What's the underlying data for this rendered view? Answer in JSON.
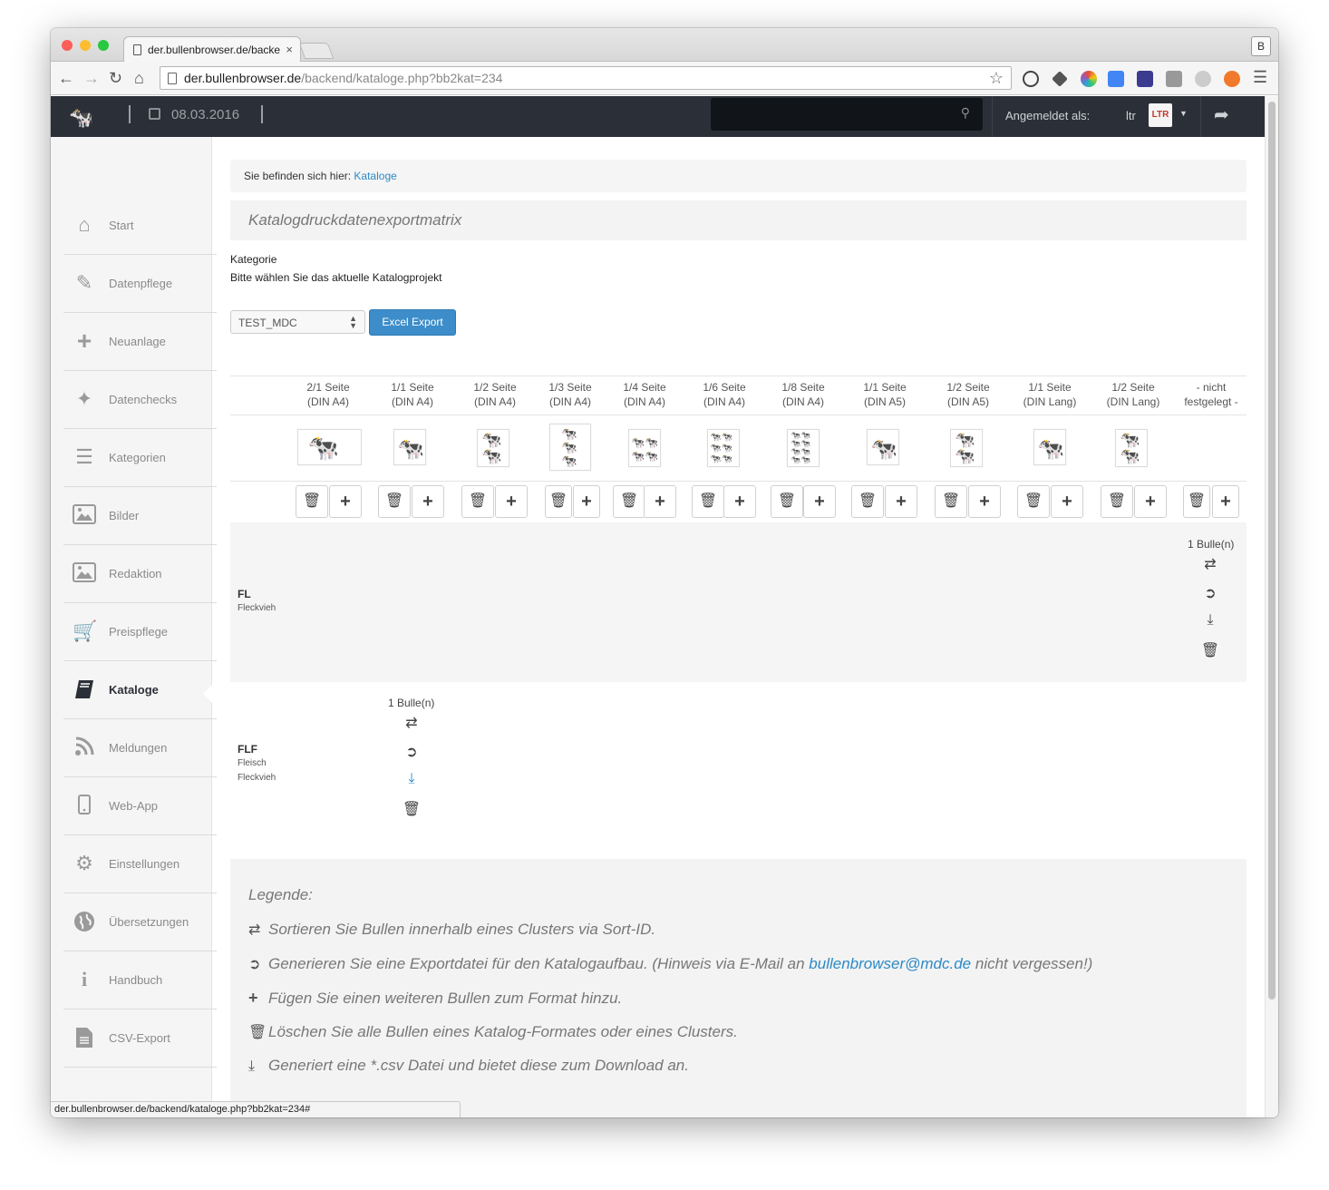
{
  "browser": {
    "tab_title": "der.bullenbrowser.de/backe",
    "tab_close": "×",
    "profile": "B",
    "url_host": "der.bullenbrowser.de",
    "url_path": "/backend/kataloge.php?bb2kat=234",
    "status_url": "der.bullenbrowser.de/backend/kataloge.php?bb2kat=234#"
  },
  "header": {
    "date": "08.03.2016",
    "login_label": "Angemeldet als:",
    "user": "ltr",
    "avatar_text": "LTR"
  },
  "sidebar": {
    "items": [
      {
        "label": "Start",
        "icon": "home-icon"
      },
      {
        "label": "Datenpflege",
        "icon": "edit-icon"
      },
      {
        "label": "Neuanlage",
        "icon": "plus-icon"
      },
      {
        "label": "Datenchecks",
        "icon": "magic-wand-icon"
      },
      {
        "label": "Kategorien",
        "icon": "list-icon"
      },
      {
        "label": "Bilder",
        "icon": "image-icon"
      },
      {
        "label": "Redaktion",
        "icon": "image-icon"
      },
      {
        "label": "Preispflege",
        "icon": "cart-icon"
      },
      {
        "label": "Kataloge",
        "icon": "book-icon"
      },
      {
        "label": "Meldungen",
        "icon": "rss-icon"
      },
      {
        "label": "Web-App",
        "icon": "mobile-icon"
      },
      {
        "label": "Einstellungen",
        "icon": "gears-icon"
      },
      {
        "label": "Übersetzungen",
        "icon": "globe-icon"
      },
      {
        "label": "Handbuch",
        "icon": "info-icon"
      },
      {
        "label": "CSV-Export",
        "icon": "file-icon"
      }
    ],
    "active": "Kataloge"
  },
  "main": {
    "breadcrumb_prefix": "Sie befinden sich hier:",
    "breadcrumb_link": "Kataloge",
    "page_title": "Katalogdruckdatenexportmatrix",
    "category_label": "Kategorie",
    "category_hint": "Bitte wählen Sie das aktuelle Katalogprojekt",
    "select_value": "TEST_MDC",
    "export_button": "Excel Export"
  },
  "matrix": {
    "columns": [
      {
        "l1": "2/1 Seite",
        "l2": "(DIN A4)"
      },
      {
        "l1": "1/1 Seite",
        "l2": "(DIN A4)"
      },
      {
        "l1": "1/2 Seite",
        "l2": "(DIN A4)"
      },
      {
        "l1": "1/3 Seite",
        "l2": "(DIN A4)"
      },
      {
        "l1": "1/4 Seite",
        "l2": "(DIN A4)"
      },
      {
        "l1": "1/6 Seite",
        "l2": "(DIN A4)"
      },
      {
        "l1": "1/8 Seite",
        "l2": "(DIN A4)"
      },
      {
        "l1": "1/1 Seite",
        "l2": "(DIN A5)"
      },
      {
        "l1": "1/2 Seite",
        "l2": "(DIN A5)"
      },
      {
        "l1": "1/1 Seite",
        "l2": "(DIN Lang)"
      },
      {
        "l1": "1/2 Seite",
        "l2": "(DIN Lang)"
      },
      {
        "l1": "- nicht",
        "l2": "festgelegt -"
      }
    ],
    "rows": [
      {
        "code": "FL",
        "name_l1": "Fleckvieh",
        "name_l2": "",
        "count": "1 Bulle(n)",
        "column": "- nicht festgelegt -"
      },
      {
        "code": "FLF",
        "name_l1": "Fleisch",
        "name_l2": "Fleckvieh",
        "count": "1 Bulle(n)",
        "column": "1/1 Seite (DIN A4)"
      }
    ]
  },
  "legend": {
    "title": "Legende:",
    "shuffle": "Sortieren Sie Bullen innerhalb eines Clusters via Sort-ID.",
    "export_pre": "Generieren Sie eine Exportdatei für den Katalogaufbau. (Hinweis via E-Mail an",
    "email": "bullenbrowser@mdc.de",
    "export_post": "nicht vergessen!)",
    "add": "Fügen Sie einen weiteren Bullen zum Format hinzu.",
    "delete": "Löschen Sie alle Bullen eines Katalog-Formates oder eines Clusters.",
    "download": "Generiert eine *.csv Datei und bietet diese zum Download an."
  },
  "colors": {
    "navbar": "#2b3038",
    "accent": "#3c8dc9",
    "link": "#2b8ac6"
  }
}
